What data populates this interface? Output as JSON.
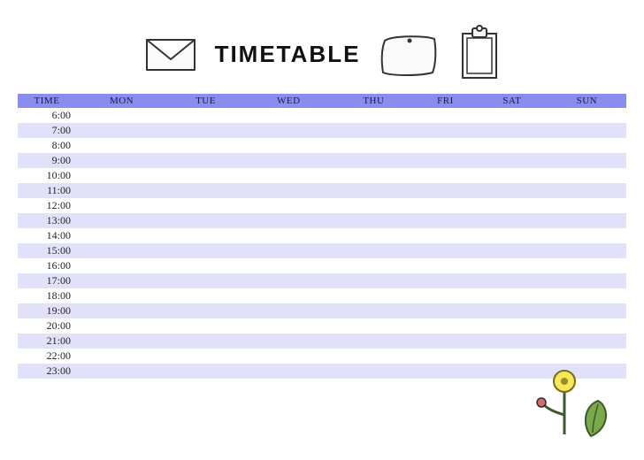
{
  "title": "TIMETABLE",
  "columns": [
    "TIME",
    "MON",
    "TUE",
    "WED",
    "THU",
    "FRI",
    "SAT",
    "SUN"
  ],
  "rows": [
    {
      "time": "6:00",
      "cells": [
        "",
        "",
        "",
        "",
        "",
        "",
        ""
      ]
    },
    {
      "time": "7:00",
      "cells": [
        "",
        "",
        "",
        "",
        "",
        "",
        ""
      ]
    },
    {
      "time": "8:00",
      "cells": [
        "",
        "",
        "",
        "",
        "",
        "",
        ""
      ]
    },
    {
      "time": "9:00",
      "cells": [
        "",
        "",
        "",
        "",
        "",
        "",
        ""
      ]
    },
    {
      "time": "10:00",
      "cells": [
        "",
        "",
        "",
        "",
        "",
        "",
        ""
      ]
    },
    {
      "time": "11:00",
      "cells": [
        "",
        "",
        "",
        "",
        "",
        "",
        ""
      ]
    },
    {
      "time": "12:00",
      "cells": [
        "",
        "",
        "",
        "",
        "",
        "",
        ""
      ]
    },
    {
      "time": "13:00",
      "cells": [
        "",
        "",
        "",
        "",
        "",
        "",
        ""
      ]
    },
    {
      "time": "14:00",
      "cells": [
        "",
        "",
        "",
        "",
        "",
        "",
        ""
      ]
    },
    {
      "time": "15:00",
      "cells": [
        "",
        "",
        "",
        "",
        "",
        "",
        ""
      ]
    },
    {
      "time": "16:00",
      "cells": [
        "",
        "",
        "",
        "",
        "",
        "",
        ""
      ]
    },
    {
      "time": "17:00",
      "cells": [
        "",
        "",
        "",
        "",
        "",
        "",
        ""
      ]
    },
    {
      "time": "18:00",
      "cells": [
        "",
        "",
        "",
        "",
        "",
        "",
        ""
      ]
    },
    {
      "time": "19:00",
      "cells": [
        "",
        "",
        "",
        "",
        "",
        "",
        ""
      ]
    },
    {
      "time": "20:00",
      "cells": [
        "",
        "",
        "",
        "",
        "",
        "",
        ""
      ]
    },
    {
      "time": "21:00",
      "cells": [
        "",
        "",
        "",
        "",
        "",
        "",
        ""
      ]
    },
    {
      "time": "22:00",
      "cells": [
        "",
        "",
        "",
        "",
        "",
        "",
        ""
      ]
    },
    {
      "time": "23:00",
      "cells": [
        "",
        "",
        "",
        "",
        "",
        "",
        ""
      ]
    }
  ]
}
